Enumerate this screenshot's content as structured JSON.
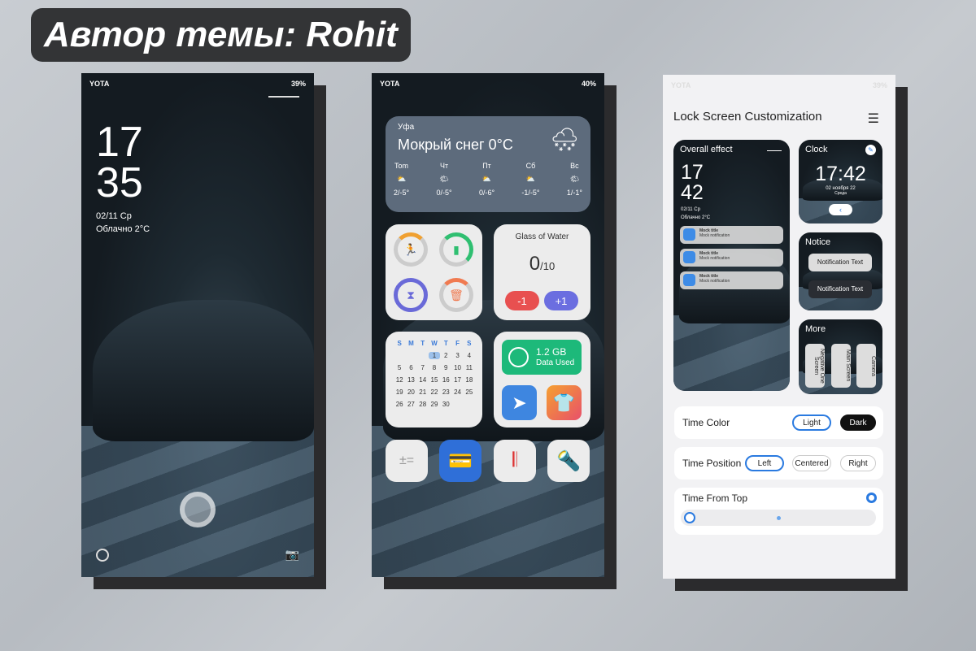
{
  "banner": "Автор темы: Rohit",
  "lock": {
    "carrier": "YOTA",
    "battery": "39%",
    "hour": "17",
    "minute": "35",
    "date": "02/11 Ср",
    "weather": "Облачно 2°C"
  },
  "home": {
    "carrier": "YOTA",
    "battery": "40%",
    "weather": {
      "city": "Уфа",
      "condition": "Мокрый снег 0°C",
      "days": [
        {
          "day": "Tom",
          "temp": "2/-5°"
        },
        {
          "day": "Чт",
          "temp": "0/-5°"
        },
        {
          "day": "Пт",
          "temp": "0/-6°"
        },
        {
          "day": "Сб",
          "temp": "-1/-5°"
        },
        {
          "day": "Вс",
          "temp": "1/-1°"
        }
      ]
    },
    "water": {
      "title": "Glass of Water",
      "count": "0",
      "total": "/10",
      "minus": "-1",
      "plus": "+1"
    },
    "calendar": {
      "weekdays": [
        "S",
        "M",
        "T",
        "W",
        "T",
        "F",
        "S"
      ],
      "days": [
        "",
        "",
        "",
        "1",
        "2",
        "3",
        "4",
        "5",
        "6",
        "7",
        "8",
        "9",
        "10",
        "11",
        "12",
        "13",
        "14",
        "15",
        "16",
        "17",
        "18",
        "19",
        "20",
        "21",
        "22",
        "23",
        "24",
        "25",
        "26",
        "27",
        "28",
        "29",
        "30"
      ],
      "today": "1"
    },
    "data": {
      "amount": "1.2 GB",
      "label": "Data Used"
    }
  },
  "custom": {
    "carrier": "YOTA",
    "battery": "39%",
    "title": "Lock Screen Customization",
    "overall": {
      "label": "Overall effect",
      "hour": "17",
      "minute": "42",
      "date": "02/11 Ср",
      "weather": "Облачно 2°C",
      "mock_title": "Mock title",
      "mock_text": "Mock notification"
    },
    "clock": {
      "label": "Clock",
      "time": "17:42",
      "date": "02 ноября 22",
      "weekday": "Среда"
    },
    "notice": {
      "label": "Notice",
      "item1": "Notification Text",
      "item2": "Notification Text"
    },
    "more": {
      "label": "More",
      "items": [
        "Negative One Screen",
        "Main Screen",
        "Camera"
      ]
    },
    "time_color": {
      "label": "Time Color",
      "options": [
        "Light",
        "Dark"
      ],
      "selected": "Light"
    },
    "time_position": {
      "label": "Time Position",
      "options": [
        "Left",
        "Centered",
        "Right"
      ],
      "selected": "Left"
    },
    "time_from_top": {
      "label": "Time From Top",
      "value": 0
    }
  }
}
